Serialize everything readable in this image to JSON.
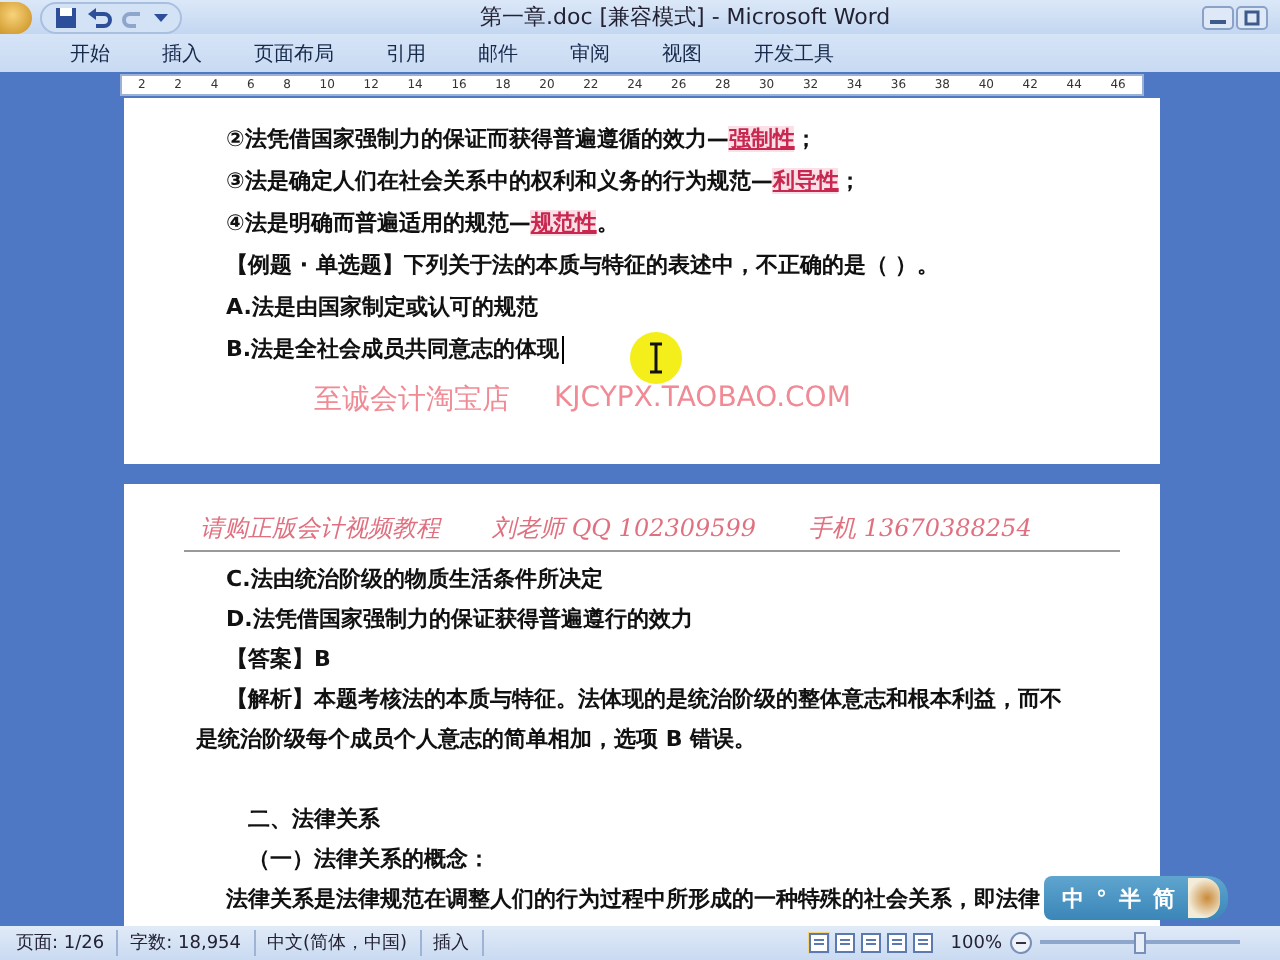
{
  "window": {
    "title": "第一章.doc [兼容模式] - Microsoft Word"
  },
  "ribbon_tabs": [
    {
      "label": "开始",
      "selected": false
    },
    {
      "label": "插入",
      "selected": false
    },
    {
      "label": "页面布局",
      "selected": false
    },
    {
      "label": "引用",
      "selected": false
    },
    {
      "label": "邮件",
      "selected": false
    },
    {
      "label": "审阅",
      "selected": false
    },
    {
      "label": "视图",
      "selected": false
    },
    {
      "label": "开发工具",
      "selected": false
    }
  ],
  "ruler": {
    "labels": [
      "2",
      "2",
      "4",
      "6",
      "8",
      "10",
      "12",
      "14",
      "16",
      "18",
      "20",
      "22",
      "24",
      "26",
      "28",
      "30",
      "32",
      "34",
      "36",
      "38",
      "40",
      "42",
      "44",
      "46"
    ]
  },
  "page_1": {
    "paragraphs": [
      {
        "kind": "point",
        "text": "②法凭借国家强制力的保证而获得普遍遵循的效力—",
        "term": "强制性",
        "tail": "；"
      },
      {
        "kind": "point",
        "text": "③法是确定人们在社会关系中的权利和义务的行为规范—",
        "term": "利导性",
        "tail": "；"
      },
      {
        "kind": "point",
        "text": "④法是明确而普遍适用的规范—",
        "term": "规范性",
        "tail": "。"
      },
      {
        "kind": "plain",
        "text": "【例题 · 单选题】下列关于法的本质与特征的表述中，不正确的是（  ）。"
      },
      {
        "kind": "plain",
        "text": "A.法是由国家制定或认可的规范"
      },
      {
        "kind": "caret",
        "text": "B.法是全社会成员共同意志的体现"
      }
    ],
    "footer": [
      "至诚会计淘宝店",
      "KJCYPX.TAOBAO.COM"
    ]
  },
  "page_2": {
    "header": [
      "请购正版会计视频教程",
      "刘老师 QQ 102309599",
      "手机 13670388254"
    ],
    "paragraphs": [
      {
        "kind": "plain",
        "text": "C.法由统治阶级的物质生活条件所决定"
      },
      {
        "kind": "plain",
        "text": "D.法凭借国家强制力的保证获得普遍遵行的效力"
      },
      {
        "kind": "plain",
        "text": "【答案】B"
      },
      {
        "kind": "wrap",
        "text": "【解析】本题考核法的本质与特征。法体现的是统治阶级的整体意志和根本利益，而不是统治阶级每个成员个人意志的简单相加，选项 B 错误。"
      },
      {
        "kind": "blank"
      },
      {
        "kind": "heading",
        "text": "二、法律关系"
      },
      {
        "kind": "heading",
        "text": "（一）法律关系的概念："
      },
      {
        "kind": "plain",
        "text": "法律关系是法律规范在调整人们的行为过程中所形成的一种特殊的社会关系，即法律"
      }
    ]
  },
  "status_bar": {
    "items": [
      "页面: 1/26",
      "字数: 18,954",
      "中文(简体，中国)",
      "插入"
    ],
    "zoom": "100%",
    "zoom_slider": {
      "level": 0.5
    }
  },
  "ime_bar": {
    "items": [
      "中",
      "°",
      "半",
      "简"
    ]
  }
}
